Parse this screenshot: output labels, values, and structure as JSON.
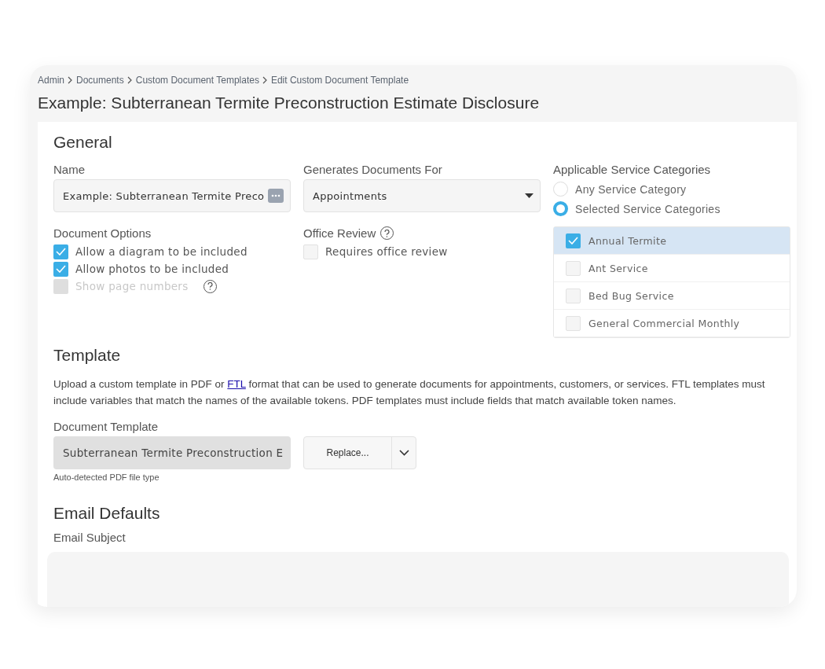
{
  "breadcrumbs": [
    "Admin",
    "Documents",
    "Custom Document Templates",
    "Edit Custom Document Template"
  ],
  "title": "Example: Subterranean Termite Preconstruction Estimate Disclosure",
  "general": {
    "heading": "General",
    "name": {
      "label": "Name",
      "value": "Example: Subterranean Termite Preco"
    },
    "generates_for": {
      "label": "Generates Documents For",
      "value": "Appointments"
    },
    "document_options": {
      "label": "Document Options",
      "options": [
        {
          "kind": "plain",
          "label": "Allow a diagram to be included",
          "checked": true,
          "disabled": false
        },
        {
          "kind": "plain",
          "label": "Allow photos to be included",
          "checked": true,
          "disabled": false
        },
        {
          "kind": "with_help",
          "label": "Show page numbers",
          "checked": false,
          "disabled": true
        }
      ]
    },
    "office_review": {
      "label": "Office Review",
      "option": {
        "label": "Requires office review",
        "checked": false
      }
    },
    "service_categories": {
      "label": "Applicable Service Categories",
      "radios": [
        {
          "label": "Any Service Category",
          "selected": false
        },
        {
          "label": "Selected Service Categories",
          "selected": true
        }
      ],
      "items": [
        {
          "label": "Annual Termite",
          "checked": true
        },
        {
          "label": "Ant Service",
          "checked": false
        },
        {
          "label": "Bed Bug Service",
          "checked": false
        },
        {
          "label": "General Commercial Monthly",
          "checked": false
        }
      ]
    }
  },
  "template": {
    "heading": "Template",
    "description_before": "Upload a custom template in PDF or ",
    "link": "FTL",
    "description_after": " format that can be used to generate documents for appointments, customers, or services. FTL templates must include variables that match the names of the available tokens. PDF templates must include fields that match available token names.",
    "field_label": "Document Template",
    "file_name": "Subterranean Termite Preconstruction E",
    "button": "Replace...",
    "hint": "Auto-detected PDF file type"
  },
  "email": {
    "heading": "Email Defaults",
    "subject_label": "Email Subject"
  }
}
